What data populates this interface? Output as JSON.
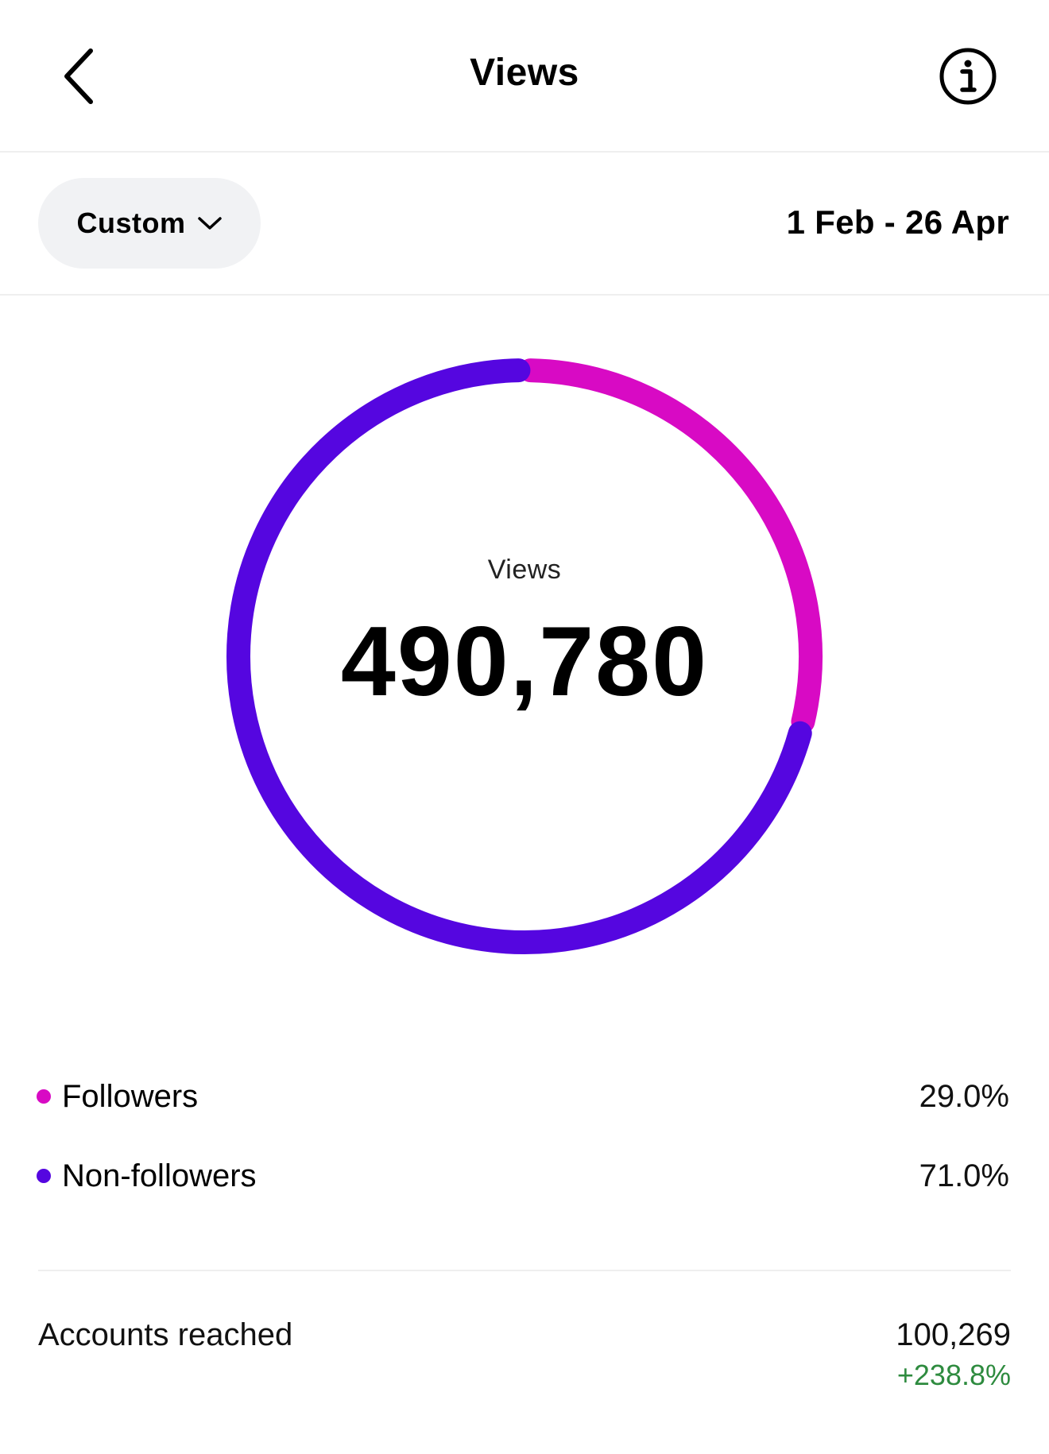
{
  "header": {
    "title": "Views",
    "back_icon": "chevron-left-icon",
    "info_icon": "info-icon"
  },
  "filter": {
    "range_option": "Custom",
    "dropdown_icon": "chevron-down-icon",
    "date_range": "1 Feb - 26 Apr"
  },
  "chart_data": {
    "type": "pie",
    "center_label": "Views",
    "center_value": "490,780",
    "series": [
      {
        "name": "Followers",
        "value": 29.0,
        "color": "#d80ac4"
      },
      {
        "name": "Non-followers",
        "value": 71.0,
        "color": "#5506e0"
      }
    ]
  },
  "legend": [
    {
      "label": "Followers",
      "value": "29.0%",
      "color": "#d80ac4"
    },
    {
      "label": "Non-followers",
      "value": "71.0%",
      "color": "#5506e0"
    }
  ],
  "metrics": {
    "accounts_reached": {
      "label": "Accounts reached",
      "value": "100,269",
      "change": "+238.8%",
      "change_color": "#2e8b3f"
    }
  }
}
